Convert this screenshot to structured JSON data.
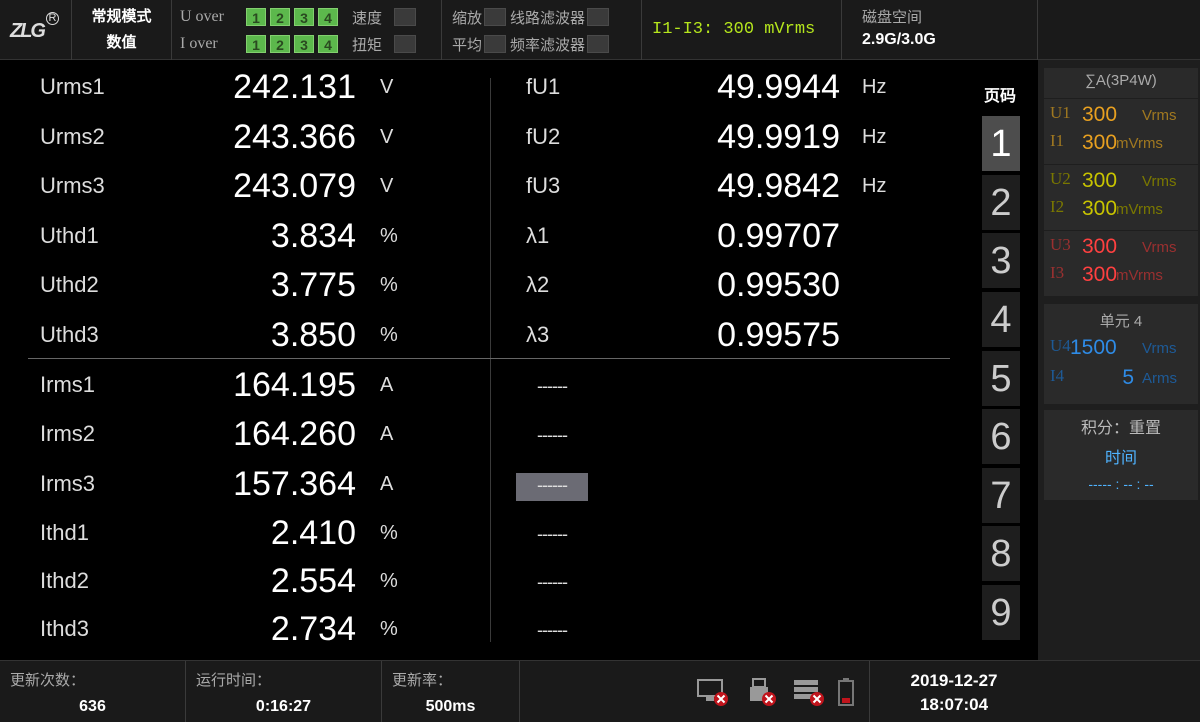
{
  "header": {
    "logo": "ZLG",
    "mode_line1": "常规模式",
    "mode_line2": "数值",
    "u_over_label": "U over",
    "i_over_label": "I over",
    "over_indicators": [
      "1",
      "2",
      "3",
      "4"
    ],
    "speed_label": "速度",
    "torque_label": "扭矩",
    "scale_label": "缩放",
    "average_label": "平均",
    "line_filter_label": "线路滤波器",
    "freq_filter_label": "频率滤波器",
    "range_text": "I1-I3: 300 mVrms",
    "disk_label": "磁盘空间",
    "disk_value": "2.9G/3.0G"
  },
  "left_rows": [
    {
      "name": "Urms1",
      "value": "242.131",
      "unit": "V"
    },
    {
      "name": "Urms2",
      "value": "243.366",
      "unit": "V"
    },
    {
      "name": "Urms3",
      "value": "243.079",
      "unit": "V"
    },
    {
      "name": "Uthd1",
      "value": "3.834",
      "unit": "%"
    },
    {
      "name": "Uthd2",
      "value": "3.775",
      "unit": "%"
    },
    {
      "name": "Uthd3",
      "value": "3.850",
      "unit": "%"
    },
    {
      "name": "Irms1",
      "value": "164.195",
      "unit": "A"
    },
    {
      "name": "Irms2",
      "value": "164.260",
      "unit": "A"
    },
    {
      "name": "Irms3",
      "value": "157.364",
      "unit": "A"
    },
    {
      "name": "Ithd1",
      "value": "2.410",
      "unit": "%"
    },
    {
      "name": "Ithd2",
      "value": "2.554",
      "unit": "%"
    },
    {
      "name": "Ithd3",
      "value": "2.734",
      "unit": "%"
    }
  ],
  "right_rows": [
    {
      "name": "fU1",
      "value": "49.9944",
      "unit": "Hz"
    },
    {
      "name": "fU2",
      "value": "49.9919",
      "unit": "Hz"
    },
    {
      "name": "fU3",
      "value": "49.9842",
      "unit": "Hz"
    },
    {
      "name": "λ1",
      "value": "0.99707",
      "unit": ""
    },
    {
      "name": "λ2",
      "value": "0.99530",
      "unit": ""
    },
    {
      "name": "λ3",
      "value": "0.99575",
      "unit": ""
    }
  ],
  "empty_slots": [
    "------",
    "------",
    "------",
    "------",
    "------",
    "------"
  ],
  "selected_empty_slot": 2,
  "pages": {
    "label": "页码",
    "items": [
      "1",
      "2",
      "3",
      "4",
      "5",
      "6",
      "7",
      "8",
      "9"
    ],
    "active": "1"
  },
  "sigma": {
    "title": "∑A(3P4W)",
    "elements": [
      {
        "u_label": "U1",
        "u_value": "300",
        "u_unit": "Vrms",
        "i_label": "I1",
        "i_value": "300",
        "i_unit": "mVrms",
        "color": "#e8a020",
        "color_dim": "#a07820"
      },
      {
        "u_label": "U2",
        "u_value": "300",
        "u_unit": "Vrms",
        "i_label": "I2",
        "i_value": "300",
        "i_unit": "mVrms",
        "color": "#c8c400",
        "color_dim": "#7a7800"
      },
      {
        "u_label": "U3",
        "u_value": "300",
        "u_unit": "Vrms",
        "i_label": "I3",
        "i_value": "300",
        "i_unit": "mVrms",
        "color": "#ff4040",
        "color_dim": "#9a3030"
      }
    ]
  },
  "unit4": {
    "title": "单元 4",
    "u_label": "U4",
    "u_value": "1500",
    "u_unit": "Vrms",
    "i_label": "I4",
    "i_value": "5",
    "i_unit": "Arms",
    "color": "#2e8be6",
    "color_dim": "#1e5a96"
  },
  "integration": {
    "title": "积分：重置",
    "sub": "时间",
    "value": "----- : -- : --"
  },
  "status": {
    "update_count_label": "更新次数：",
    "update_count": "636",
    "run_time_label": "运行时间：",
    "run_time": "0:16:27",
    "update_rate_label": "更新率：",
    "update_rate": "500ms",
    "date": "2019-12-27",
    "time": "18:07:04"
  }
}
